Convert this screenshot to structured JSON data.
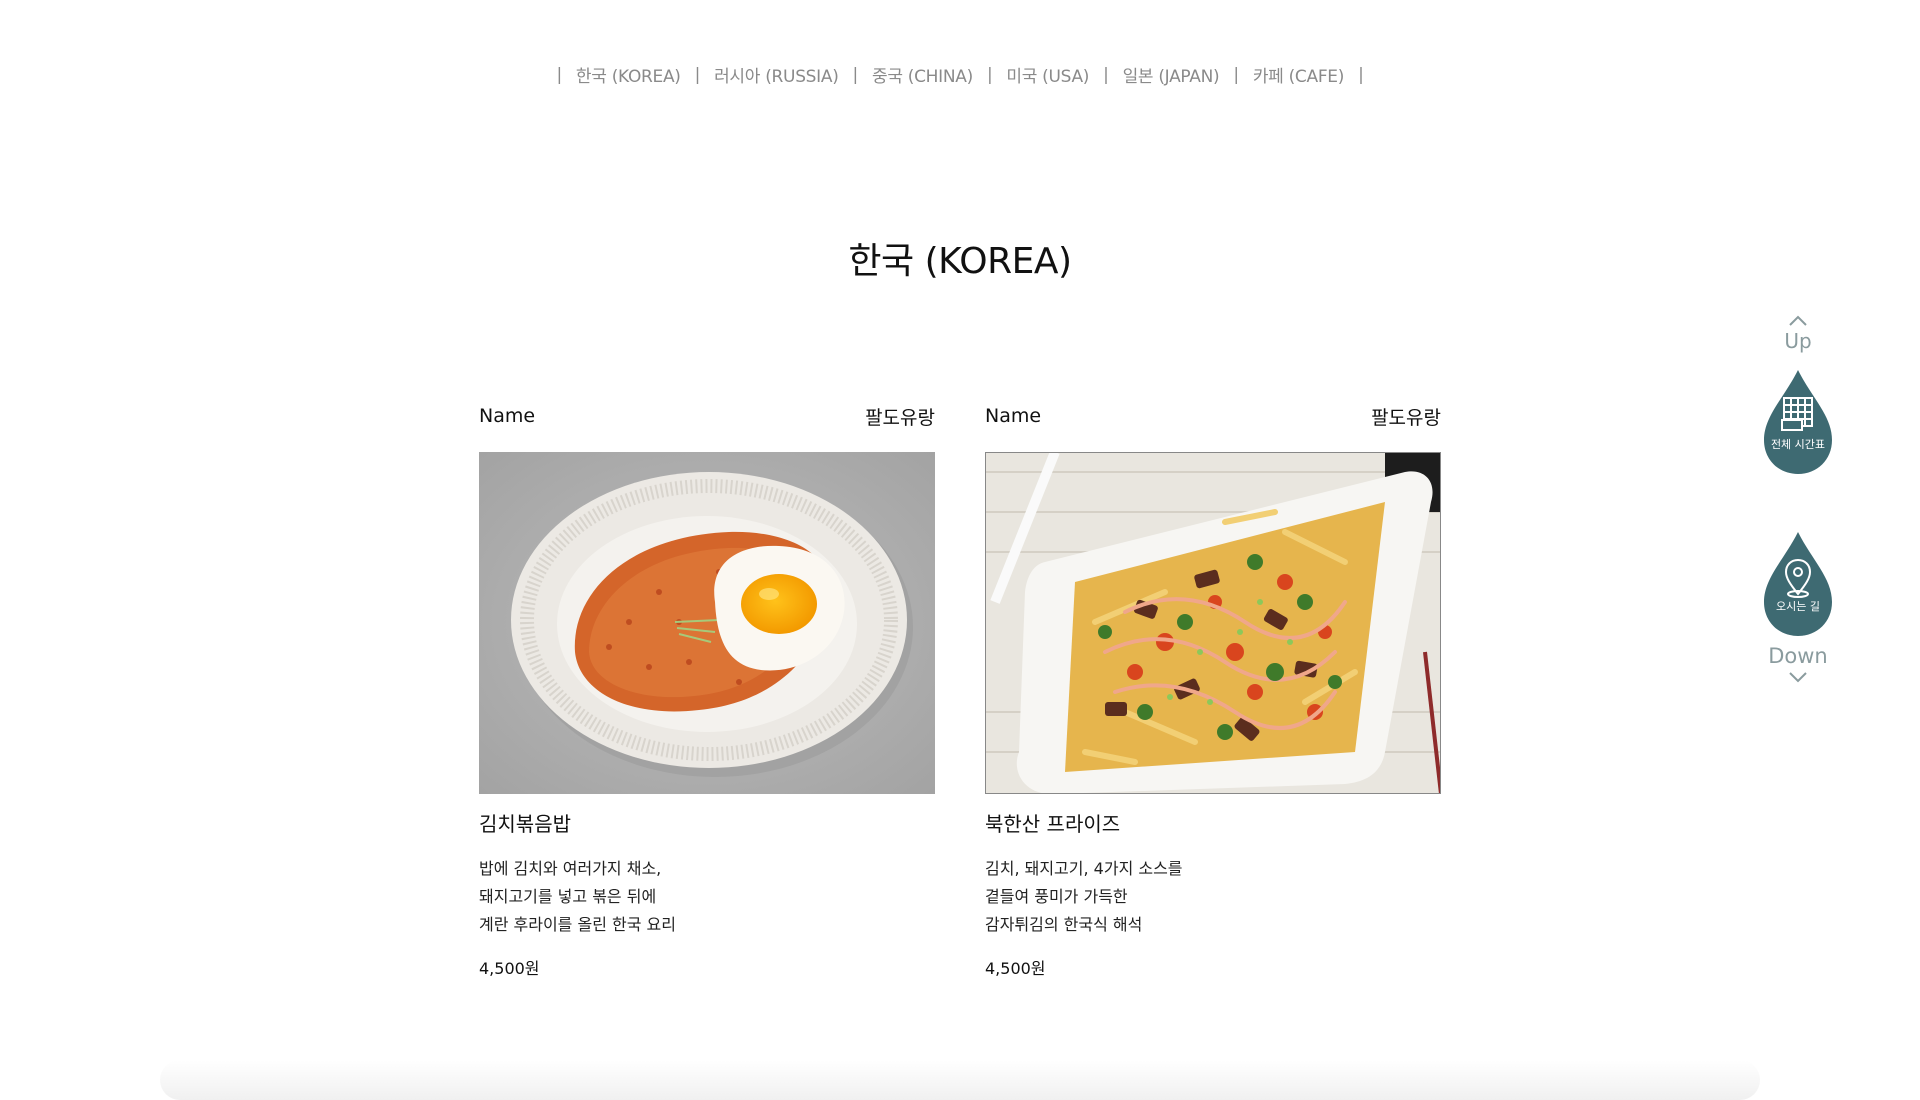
{
  "nav": {
    "items": [
      {
        "label": "한국 (KOREA)"
      },
      {
        "label": "러시아 (RUSSIA)"
      },
      {
        "label": "중국 (CHINA)"
      },
      {
        "label": "미국 (USA)"
      },
      {
        "label": "일본 (JAPAN)"
      },
      {
        "label": "카페 (CAFE)"
      }
    ],
    "separator": "|"
  },
  "section": {
    "title": "한국 (KOREA)"
  },
  "cards": [
    {
      "header_left": "Name",
      "header_right": "팔도유랑",
      "image": "kimchi-fried-rice-photo",
      "name": "김치볶음밥",
      "desc": [
        "밥에 김치와 여러가지 채소,",
        "돼지고기를 넣고 볶은 뒤에",
        "계란 후라이를 올린 한국 요리"
      ],
      "price": "4,500원"
    },
    {
      "header_left": "Name",
      "header_right": "팔도유랑",
      "image": "bukhansan-fries-photo",
      "name": "북한산 프라이즈",
      "desc": [
        "김치, 돼지고기, 4가지 소스를",
        "곁들여 풍미가 가득한",
        "감자튀김의 한국식 해석"
      ],
      "price": "4,500원"
    }
  ],
  "side": {
    "up_label": "Up",
    "down_label": "Down",
    "timetable_label": "전체 시간표",
    "directions_label": "오시는 길",
    "accent": "#3e6a72"
  }
}
